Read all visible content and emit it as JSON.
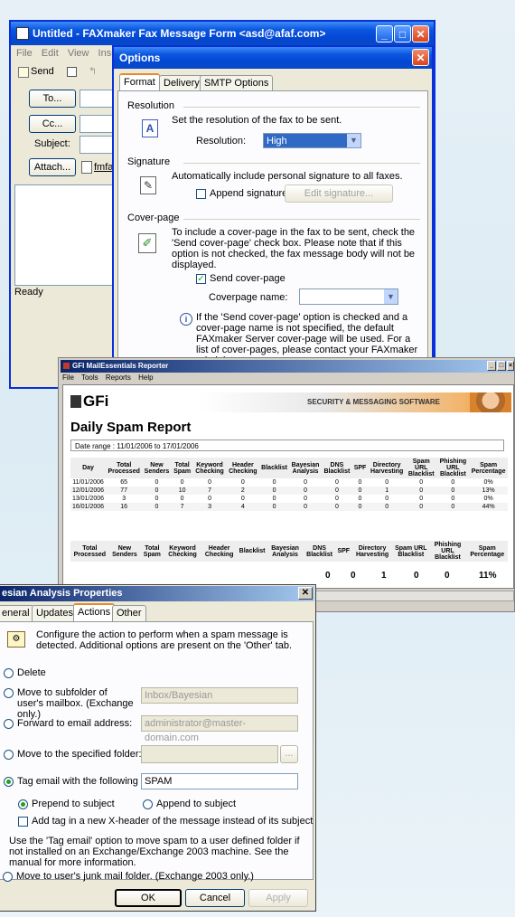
{
  "fax": {
    "title": "Untitled - FAXmaker Fax Message Form <asd@afaf.com>",
    "menu": [
      "File",
      "Edit",
      "View",
      "Inse"
    ],
    "send_label": "Send",
    "to_label": "To...",
    "cc_label": "Cc...",
    "subject_label": "Subject:",
    "attach_label": "Attach...",
    "attachment_name": "fmfax",
    "status": "Ready"
  },
  "options": {
    "title": "Options",
    "tabs": [
      "Format",
      "Delivery",
      "SMTP Options"
    ],
    "resolution_heading": "Resolution",
    "resolution_desc": "Set the resolution of the fax to be sent.",
    "resolution_label": "Resolution:",
    "resolution_value": "High",
    "signature_heading": "Signature",
    "signature_desc": "Automatically include personal signature to all faxes.",
    "append_signature_label": "Append signature",
    "append_signature_checked": false,
    "edit_signature_label": "Edit signature...",
    "coverpage_heading": "Cover-page",
    "coverpage_desc": "To include a cover-page in the fax to be sent, check the 'Send cover-page' check box. Please note that if this option is not checked, the fax message body will not be displayed.",
    "send_coverpage_label": "Send cover-page",
    "send_coverpage_checked": true,
    "coverpage_name_label": "Coverpage name:",
    "coverpage_name_value": "",
    "info_text": "If the 'Send cover-page' option is checked and a cover-page name is not specified, the default FAXmaker Server cover-page will be used. For a list of cover-pages, please contact your FAXmaker administrator."
  },
  "reporter": {
    "title": "GFI MailEssentials Reporter",
    "menu": [
      "File",
      "Tools",
      "Reports",
      "Help"
    ],
    "logo": "GFi",
    "banner": "SECURITY & MESSAGING SOFTWARE",
    "report_title": "Daily Spam Report",
    "date_range": "Date range : 11/01/2006 to 17/01/2006",
    "columns": [
      "Day",
      "Total Processed",
      "New Senders",
      "Total Spam",
      "Keyword Checking",
      "Header Checking",
      "Blacklist",
      "Bayesian Analysis",
      "DNS Blacklist",
      "SPF",
      "Directory Harvesting",
      "Spam URL Blacklist",
      "Phishing URL Blacklist",
      "Spam Percentage"
    ],
    "rows": [
      [
        "11/01/2006",
        "65",
        "0",
        "0",
        "0",
        "0",
        "0",
        "0",
        "0",
        "0",
        "0",
        "0",
        "0",
        "0%"
      ],
      [
        "12/01/2006",
        "77",
        "0",
        "10",
        "7",
        "2",
        "0",
        "0",
        "0",
        "0",
        "1",
        "0",
        "0",
        "13%"
      ],
      [
        "13/01/2006",
        "3",
        "0",
        "0",
        "0",
        "0",
        "0",
        "0",
        "0",
        "0",
        "0",
        "0",
        "0",
        "0%"
      ],
      [
        "16/01/2006",
        "16",
        "0",
        "7",
        "3",
        "4",
        "0",
        "0",
        "0",
        "0",
        "0",
        "0",
        "0",
        "44%"
      ]
    ],
    "total_columns": [
      "Total Processed",
      "New Senders",
      "Total Spam",
      "Keyword Checking",
      "Header Checking",
      "Blacklist",
      "Bayesian Analysis",
      "DNS Blacklist",
      "SPF",
      "Directory Harvesting",
      "Spam URL Blacklist",
      "Phishing URL Blacklist",
      "Spam Percentage"
    ],
    "totals_visible": [
      "0",
      "0",
      "1",
      "0",
      "0",
      "11%"
    ]
  },
  "bayes": {
    "title": "esian Analysis Properties",
    "tabs": [
      "eneral",
      "Updates",
      "Actions",
      "Other"
    ],
    "intro": "Configure the action to perform when a spam message is detected. Additional options are present on the 'Other' tab.",
    "opt_delete": "Delete",
    "opt_move_subfolder": "Move to subfolder of user's mailbox. (Exchange only.)",
    "subfolder_value": "Inbox/Bayesian",
    "opt_forward": "Forward to email address:",
    "forward_value": "administrator@master-domain.com",
    "opt_move_folder": "Move to the specified folder:",
    "move_folder_value": "",
    "browse_label": "...",
    "opt_tag": "Tag email with the following text:",
    "tag_value": "SPAM",
    "prepend_label": "Prepend to subject",
    "append_label": "Append to subject",
    "xheader_label": "Add tag in a new X-header of the message instead of its subject",
    "note": "Use the 'Tag email' option to move spam to a user defined folder if not installed on an Exchange/Exchange 2003 machine. See the manual for more information.",
    "opt_junk": "Move to user's junk mail folder. (Exchange 2003 only.)",
    "ok_label": "OK",
    "cancel_label": "Cancel",
    "apply_label": "Apply"
  }
}
